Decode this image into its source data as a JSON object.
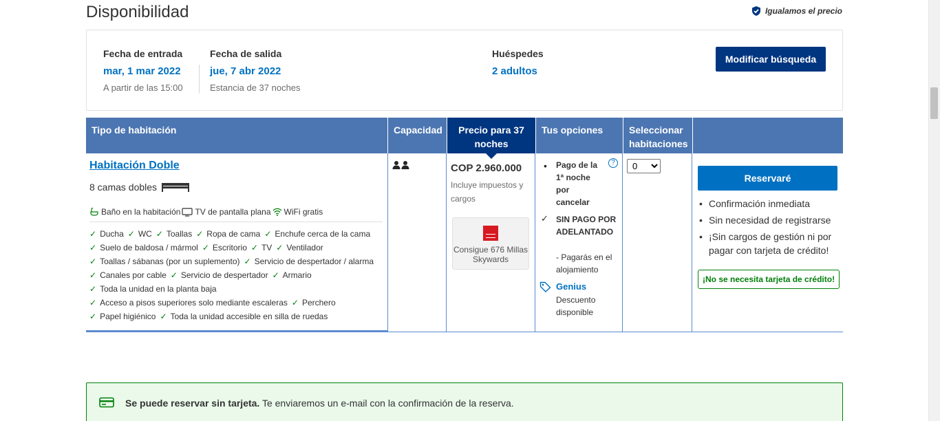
{
  "page": {
    "title": "Disponibilidad",
    "price_match": "Igualamos el precio"
  },
  "search": {
    "checkin_label": "Fecha de entrada",
    "checkin_value": "mar, 1 mar 2022",
    "checkin_sub": "A partir de las 15:00",
    "checkout_label": "Fecha de salida",
    "checkout_value": "jue, 7 abr 2022",
    "checkout_sub": "Estancia de 37 noches",
    "guests_label": "Huéspedes",
    "guests_value": "2 adultos",
    "modify_button": "Modificar búsqueda"
  },
  "table": {
    "headers": {
      "room_type": "Tipo de habitación",
      "capacity": "Capacidad",
      "price": "Precio para 37 noches",
      "options": "Tus opciones",
      "select": "Seleccionar habitaciones"
    }
  },
  "room": {
    "name": "Habitación Doble",
    "beds": "8 camas dobles",
    "top_amenities": [
      "Baño en la habitación",
      "TV de pantalla plana",
      "WiFi gratis"
    ],
    "facilities": [
      [
        "Ducha",
        "WC",
        "Toallas",
        "Ropa de cama",
        "Enchufe cerca de la cama"
      ],
      [
        "Suelo de baldosa / mármol",
        "Escritorio",
        "TV",
        "Ventilador"
      ],
      [
        "Toallas / sábanas (por un suplemento)",
        "Servicio de despertador / alarma"
      ],
      [
        "Canales por cable",
        "Servicio de despertador",
        "Armario"
      ],
      [
        "Toda la unidad en la planta baja"
      ],
      [
        "Acceso a pisos superiores solo mediante escaleras",
        "Perchero"
      ],
      [
        "Papel higiénico",
        "Toda la unidad accesible en silla de ruedas"
      ]
    ],
    "capacity_icon": "two-persons-icon",
    "price": "COP 2.960.000",
    "price_note": "Incluye impuestos y cargos",
    "miles_text": "Consigue 676 Millas Skywards",
    "options": {
      "cancel": "Pago de la 1ª noche por cancelar",
      "help": "?",
      "no_prepay": "SIN PAGO POR ADELANTADO",
      "no_prepay_sub": "- Pagarás en el alojamiento",
      "genius": "Genius",
      "genius_sub": "Descuento disponible"
    },
    "select_options": [
      "0"
    ],
    "select_value": "0"
  },
  "reserve": {
    "button": "Reservaré",
    "bullets": [
      "Confirmación inmediata",
      "Sin necesidad de registrarse",
      "¡Sin cargos de gestión ni por pagar con tarjeta de crédito!"
    ],
    "no_card_badge": "¡No se necesita tarjeta de crédito!"
  },
  "banner": {
    "bold": "Se puede reservar sin tarjeta.",
    "text": " Te enviaremos un e-mail con la confirmación de la reserva."
  },
  "colors": {
    "header_blue": "#4c76b2",
    "dark_blue": "#003580",
    "link_blue": "#0071c2",
    "green": "#008009"
  }
}
